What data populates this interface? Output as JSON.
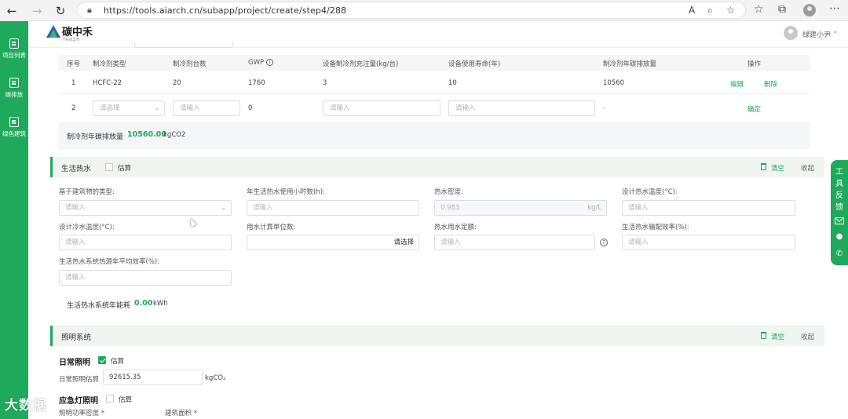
{
  "browser": {
    "url": "https://tools.aiarch.cn/subapp/project/create/step4/288",
    "reader_label": "A"
  },
  "sidebar": {
    "items": [
      {
        "label": "项目列表"
      },
      {
        "label": "碳排放"
      },
      {
        "label": "绿色建筑"
      }
    ]
  },
  "header": {
    "logo_text": "碳中禾",
    "logo_sub": "TANZH",
    "user_name": "绿建小尹"
  },
  "refrigerant": {
    "columns": [
      "序号",
      "制冷剂类型",
      "制冷剂台数",
      "GWP",
      "设备制冷剂充注量(kg/台)",
      "设备使用寿命(年)",
      "制冷剂年碳排放量",
      "操作"
    ],
    "rows": [
      {
        "no": "1",
        "type": "HCFC-22",
        "count": "20",
        "gwp": "1760",
        "charge": "3",
        "life": "10",
        "annual": "10560",
        "edit": "编辑",
        "delete": "删除"
      }
    ],
    "new_row": {
      "no": "2",
      "type_placeholder": "请选择",
      "count_placeholder": "请输入",
      "gwp": "0",
      "charge_placeholder": "请输入",
      "life_placeholder": "请输入",
      "annual": "-",
      "confirm": "确定"
    },
    "total_label": "制冷剂年碳排放量",
    "total_value": "10560.00",
    "total_unit": "kgCO2"
  },
  "hot_water": {
    "title": "生活热水",
    "estimate_label": "估算",
    "estimate_checked": false,
    "clear_label": "清空",
    "collapse_label": "收起",
    "fields": {
      "building_type": {
        "label": "基于建筑物的类型:",
        "placeholder": "请输入"
      },
      "annual_hours": {
        "label": "年生活热水使用小时数(h):",
        "placeholder": "请输入"
      },
      "density": {
        "label": "热水密度:",
        "value": "0.983",
        "unit": "kg/L"
      },
      "design_hot_temp": {
        "label": "设计热水温度(°C):",
        "placeholder": "请输入"
      },
      "design_cold_temp": {
        "label": "设计冷水温度(°C):",
        "placeholder": "请输入"
      },
      "unit_count": {
        "label": "用水计算单位数:",
        "select_label": "请选择"
      },
      "quota": {
        "label": "热水用水定额:",
        "placeholder": "请输入"
      },
      "distribution_eff": {
        "label": "生活热水输配效率(%):",
        "placeholder": "请输入"
      },
      "heat_source_eff": {
        "label": "生活热水系统热源年平均效率(%):",
        "placeholder": "请输入"
      }
    },
    "energy_label": "生活热水系统年能耗",
    "energy_value": "0.00",
    "energy_unit": "kWh"
  },
  "lighting": {
    "title": "照明系统",
    "clear_label": "清空",
    "collapse_label": "收起",
    "daily": {
      "title": "日常照明",
      "estimate_label": "估算",
      "estimate_checked": true,
      "estimate_field_label": "日常照明估算",
      "estimate_value": "92615.35",
      "unit": "kgCO₂"
    },
    "emergency": {
      "title": "应急灯照明",
      "estimate_label": "估算",
      "estimate_checked": false,
      "density_label": "照明功率密度 *",
      "area_label": "建筑面积 *"
    }
  },
  "feedback": {
    "text": "工具反馈"
  },
  "watermark": "大数据"
}
